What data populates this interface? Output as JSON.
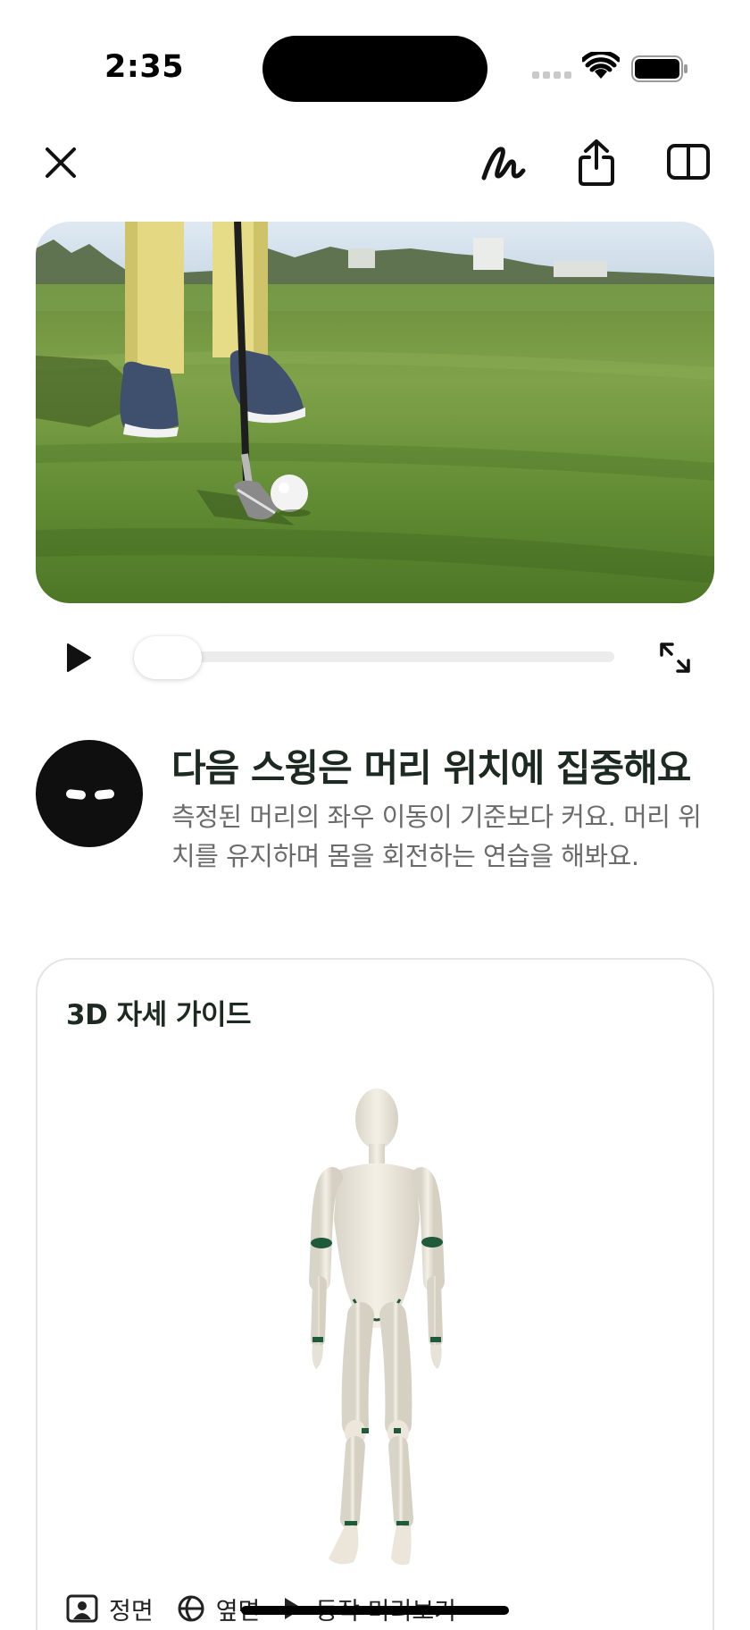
{
  "status_bar": {
    "time": "2:35"
  },
  "toolbar": {
    "close_icon": "close-icon",
    "draw_icon": "draw-icon",
    "share_icon": "share-icon",
    "split_icon": "split-view-icon"
  },
  "player": {
    "play_icon": "play-icon",
    "expand_icon": "expand-icon",
    "progress": 0.03
  },
  "feedback": {
    "title": "다음 스윙은 머리 위치에 집중해요",
    "body": "측정된 머리의 좌우 이동이 기준보다 커요. 머리 위치를 유지하며 몸을 회전하는 연습을 해봐요."
  },
  "guide": {
    "title": "3D 자세 가이드",
    "views": [
      {
        "label": "정면",
        "icon": "person-frame-icon"
      },
      {
        "label": "옆면",
        "icon": "globe-icon"
      },
      {
        "label": "동작 미리보기",
        "icon": "play-icon"
      }
    ]
  },
  "colors": {
    "accent_dark_green": "#1c2a22",
    "joint_green": "#1f5a3a"
  }
}
